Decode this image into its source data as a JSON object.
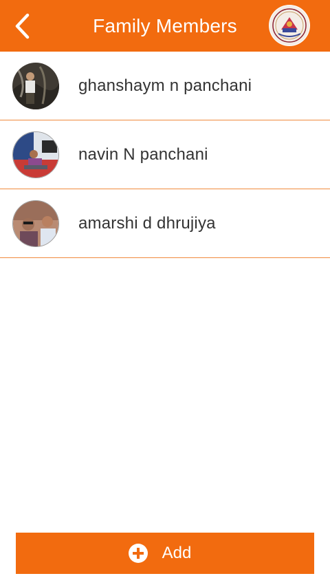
{
  "colors": {
    "primary": "#f26b0f",
    "divider": "#f08a3c",
    "text": "#333333"
  },
  "header": {
    "title": "Family Members",
    "back_icon": "chevron-left-icon",
    "logo": "organization-logo"
  },
  "members": [
    {
      "name": "ghanshaym n panchani",
      "avatar": "profile-photo"
    },
    {
      "name": "navin N panchani",
      "avatar": "profile-photo"
    },
    {
      "name": "amarshi d dhrujiya",
      "avatar": "profile-photo"
    }
  ],
  "footer": {
    "add_label": "Add",
    "add_icon": "plus-circle-icon"
  }
}
